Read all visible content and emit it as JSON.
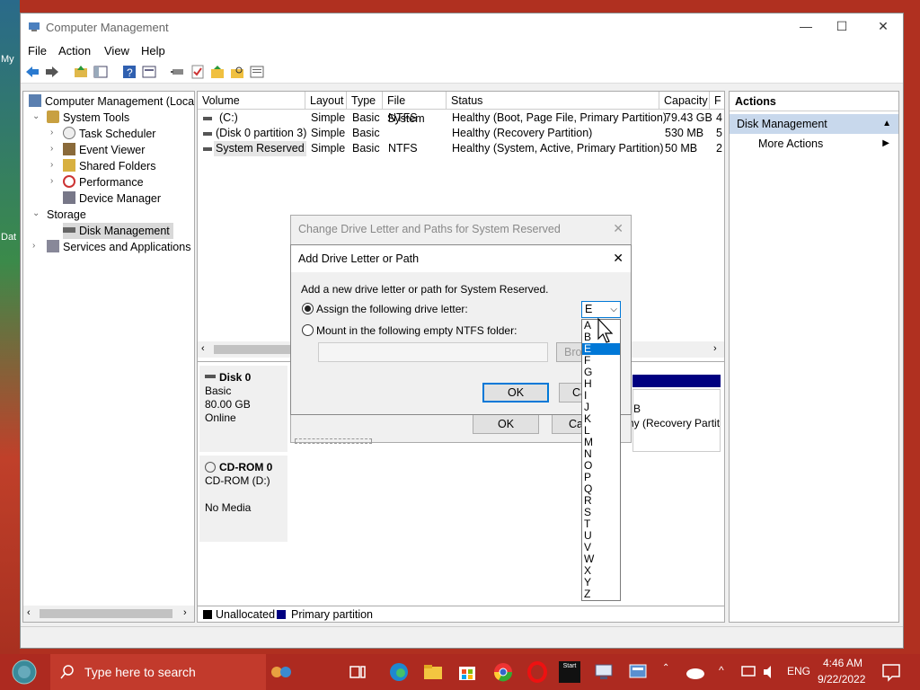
{
  "desktop": {
    "labels": [
      "My",
      "Dat"
    ]
  },
  "window": {
    "title": "Computer Management",
    "controls": {
      "min": "—",
      "max": "☐",
      "close": "✕"
    }
  },
  "menu": {
    "file": "File",
    "action": "Action",
    "view": "View",
    "help": "Help"
  },
  "toolbar": {
    "icons": [
      "back-arrow-icon",
      "forward-arrow-icon",
      "up-folder-icon",
      "show-tree-icon",
      "help-icon",
      "properties-icon",
      "connect-icon",
      "check-icon",
      "export-icon",
      "search-icon",
      "list-icon"
    ]
  },
  "tree": {
    "root": "Computer Management (Local",
    "system_tools": "System Tools",
    "task_scheduler": "Task Scheduler",
    "event_viewer": "Event Viewer",
    "shared_folders": "Shared Folders",
    "performance": "Performance",
    "device_manager": "Device Manager",
    "storage": "Storage",
    "disk_management": "Disk Management",
    "services_apps": "Services and Applications"
  },
  "volumes": {
    "headers": [
      "Volume",
      "Layout",
      "Type",
      "File System",
      "Status",
      "Capacity",
      "F"
    ],
    "rows": [
      {
        "volume": "(C:)",
        "layout": "Simple",
        "type": "Basic",
        "fs": "NTFS",
        "status": "Healthy (Boot, Page File, Primary Partition)",
        "capacity": "79.43 GB",
        "free": "4"
      },
      {
        "volume": "(Disk 0 partition 3)",
        "layout": "Simple",
        "type": "Basic",
        "fs": "",
        "status": "Healthy (Recovery Partition)",
        "capacity": "530 MB",
        "free": "5"
      },
      {
        "volume": "System Reserved",
        "layout": "Simple",
        "type": "Basic",
        "fs": "NTFS",
        "status": "Healthy (System, Active, Primary Partition)",
        "capacity": "50 MB",
        "free": "2"
      }
    ]
  },
  "disks": {
    "disk0": {
      "name": "Disk 0",
      "type": "Basic",
      "size": "80.00 GB",
      "state": "Online",
      "partial1": "B",
      "partial2": "hy (Recovery Partit"
    },
    "cdrom0": {
      "name": "CD-ROM 0",
      "type": "CD-ROM (D:)",
      "state": "No Media"
    }
  },
  "legend": {
    "unallocated": "Unallocated",
    "primary": "Primary partition",
    "unalloc_color": "#000000",
    "primary_color": "#000080"
  },
  "actions": {
    "header": "Actions",
    "selected": "Disk Management",
    "more": "More Actions"
  },
  "dialog_back": {
    "title": "Change Drive Letter and Paths for System Reserved",
    "ok": "OK",
    "cancel": "Ca"
  },
  "dialog_front": {
    "title": "Add Drive Letter or Path",
    "desc": "Add a new drive letter or path for System Reserved.",
    "assign": "Assign the following drive letter:",
    "mount": "Mount in the following empty NTFS folder:",
    "browse": "Bro",
    "ok": "OK",
    "cancel": "Ca",
    "selected_letter": "E",
    "letters": [
      "A",
      "B",
      "E",
      "F",
      "G",
      "H",
      "I",
      "J",
      "K",
      "L",
      "M",
      "N",
      "O",
      "P",
      "Q",
      "R",
      "S",
      "T",
      "U",
      "V",
      "W",
      "X",
      "Y",
      "Z"
    ],
    "highlighted": "E"
  },
  "taskbar": {
    "search_placeholder": "Type here to search",
    "time": "4:46 AM",
    "date": "9/22/2022",
    "lang": "ENG",
    "start_label": "Start"
  },
  "colors": {
    "accent": "#0078d7",
    "taskbar": "#ad2a20",
    "selection": "#c8d8ec"
  }
}
